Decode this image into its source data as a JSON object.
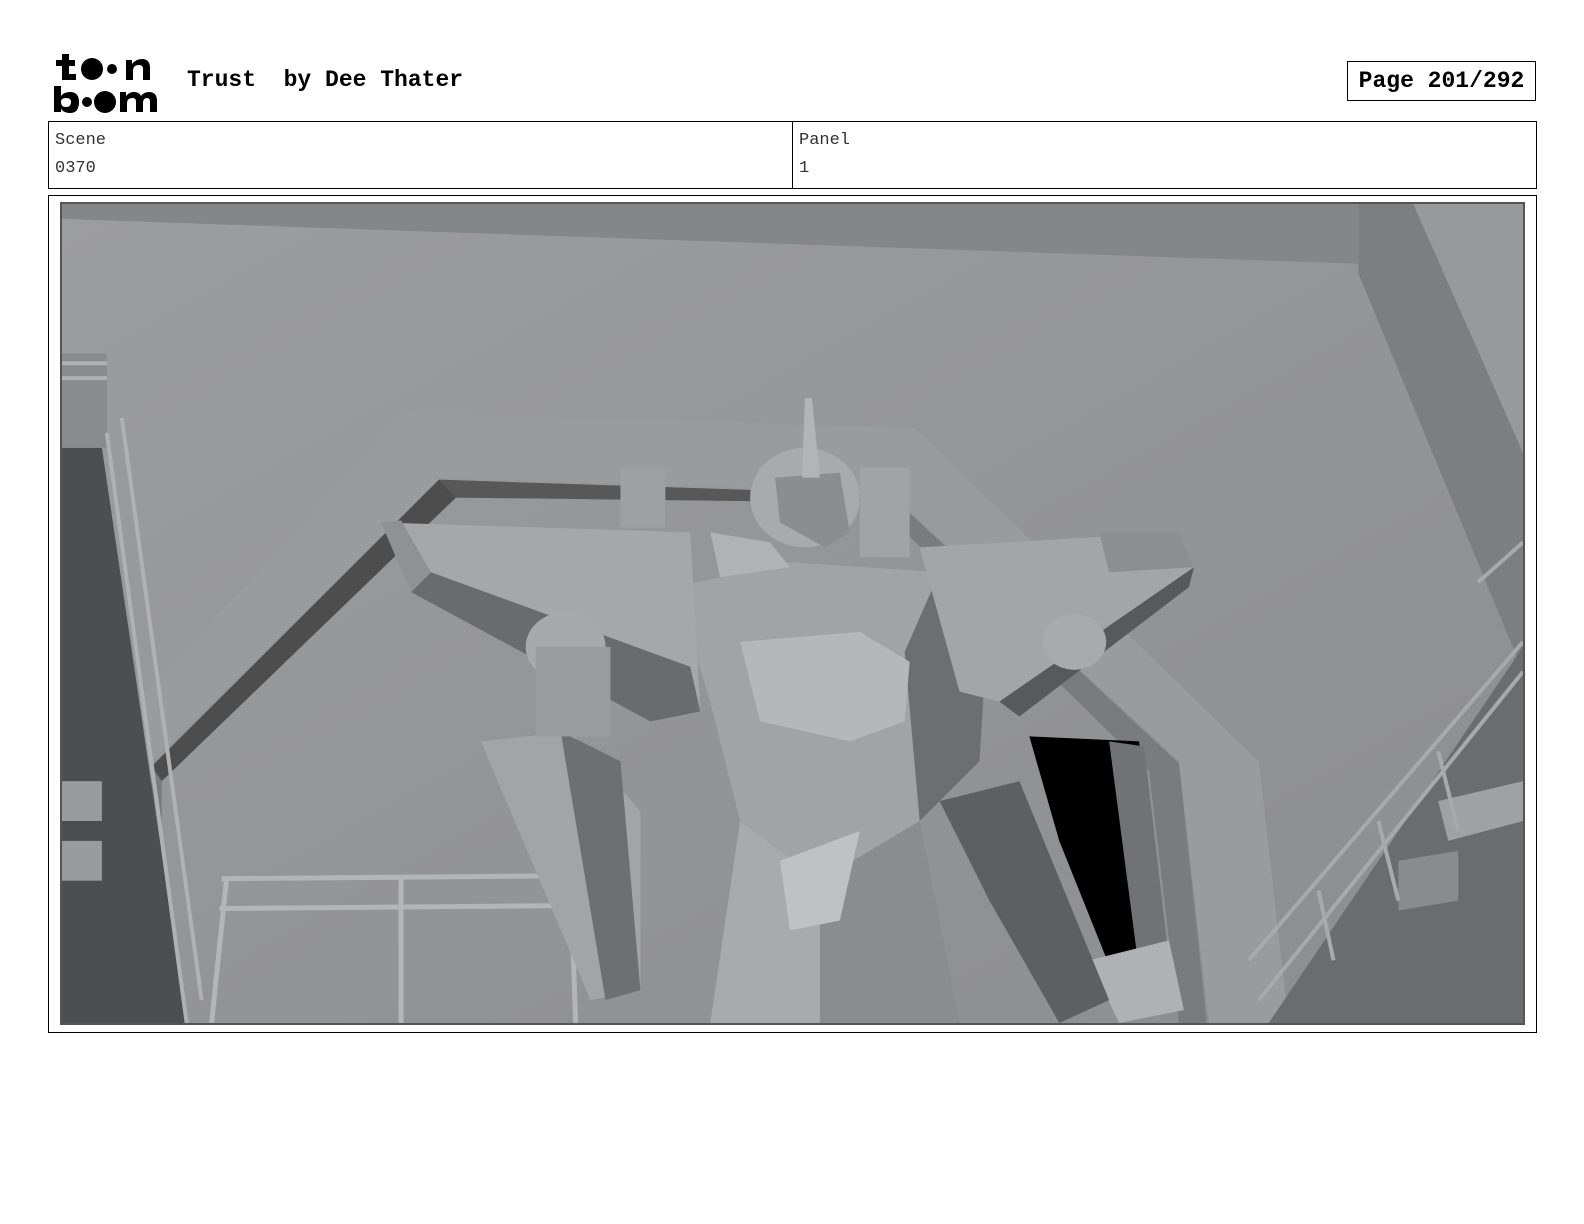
{
  "header": {
    "logo_text_top": "toon",
    "logo_text_bottom": "boom",
    "title": "Trust  by Dee Thater",
    "page": "Page 201/292"
  },
  "info": {
    "scene_label": "Scene",
    "scene_value": "0370",
    "panel_label": "Panel",
    "panel_value": "1"
  },
  "panel": {
    "image_subject": "grey-3d-render-robot-in-hangar",
    "colors": {
      "background": "#8e8f91",
      "dark": "#4a4a4c",
      "light": "#b4b5b7"
    }
  }
}
